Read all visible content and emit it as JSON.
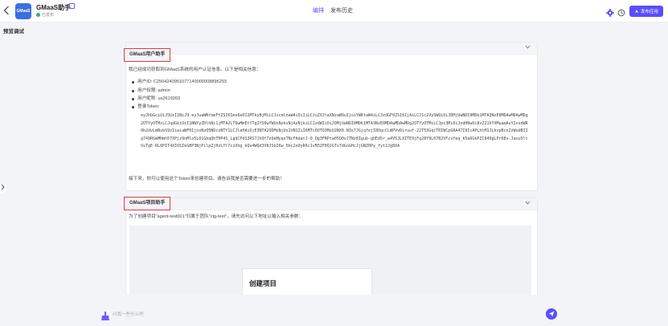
{
  "header": {
    "back_icon": "chevron-left-icon",
    "logo_text": "GMaaS",
    "app_title": "GMaaS助手",
    "publish_status": "已发布",
    "tabs": [
      {
        "label": "编排",
        "active": true
      },
      {
        "label": "发布历史",
        "active": false
      }
    ],
    "publish_button": "发布应用",
    "accent_color": "#5b4cff"
  },
  "sub_title": "预览调试",
  "card1": {
    "title": "GMaaS用户助手",
    "intro": "我已经成功获取到GMaaS系统的用户认证信息。以下是相关信息：",
    "items": [
      "用户ID: C2504240951077140000008896293",
      "用户权限: admin",
      "用户昵称: ux2619263",
      "登录Token:"
    ],
    "token": "eyJhbGciOiJSUzI1NiJ9.eyJuaWNrbmFtZSI6Imx6eDI2MTkyNjMiLCJvcmlnaW4iOiIiLCJuZXJtaXNzaW9uIjoiYWRtaW4iLCJzdGF0ZSI6IjAiLCJ1c2VySWQiOiJDMjUwNDI0MDk1MTA3NzE0MDAwMDAwMDg2OTYyOTMiLCJqdGkiOiI1NWYyZDlhNi1jMTA2LTQwMmEtYTg2YS0wYWUxNzkxNjAzNjkiLCJzdWIiOiJDMjUwNDI0MDk1MTA3NzE0MDAwMDAwMDg2OTYyOTMiLCJpc3MiOiJodHRwOi8vZ21hYXMuamAuY2xvdWR0b2dvLmNvbS9zIiwiaWF0IjoxNzQ5NDczNTY1LCJleHAiOjE3NTA2ODMxNjUsInN1ZiI6MTc0OTQ3MzU2NX0.N3x7JGjqfejI8OqcCLWPVvRiruuf-22T5XGqcTRIWCpGRA47I9IcAPLhtM1JLkvpBcnZzWudBIIg749RGmMHmh57XPjz9nMlo5L01GbqQhTHP4S_LgdCPdS3RS7JhQf7zQeMyqsTNcFAdatJ-0_Qg3FRPta05Q0vJTNz8Igub-gUEd5r_w4V5JLXITE9jFq28Y9L07B2VFcvYeq_k5a6GkPZC849gLPrD8v-Jaxu5ltSvTgE-RL0PIT4XIOSIkGBP3NjPilpZjHzLYl7czXhg_kQu4WQd3V8JSbI6w_5bc2n0yR6c1vM32F8QJGTv7dGoGHcJjGNZ0Py_fyt1Jg8XA",
    "next": "接下来，你可以使用这个Token来创建项目。请告诉我是否需要进一步的帮助！",
    "chevron_icon": "chevron-down-icon"
  },
  "card2": {
    "title": "GMaaS项目助手",
    "intro": "为了创建项目\"agent-test001\"归属于团队\"ctg-test\"，请先访问以下地址以输入相关参数：",
    "dialog_title": "创建项目",
    "chevron_icon": "chevron-down-icon"
  },
  "input": {
    "placeholder": "问我一些什么吧",
    "send_icon": "send-icon"
  }
}
